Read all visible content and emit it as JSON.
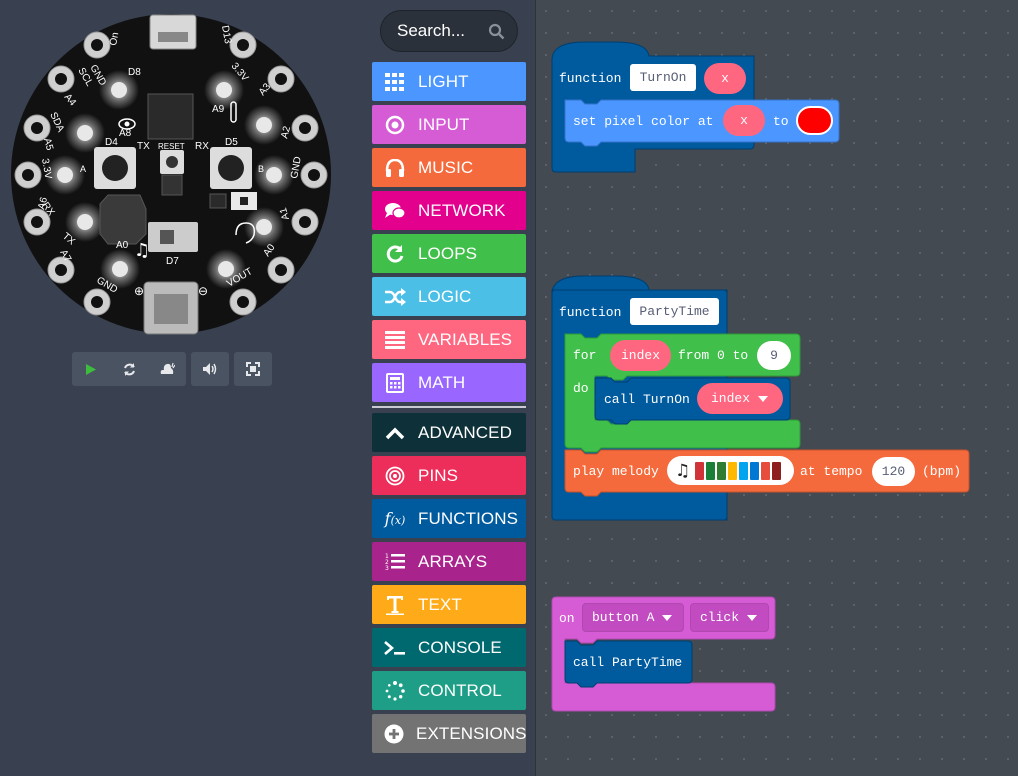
{
  "simulator": {
    "board_labels": {
      "on": "On",
      "d13": "D13",
      "gnd": "GND",
      "three_v": "3.3V",
      "d8": "D8",
      "scl": "SCL",
      "a4": "A4",
      "a3": "A3",
      "a9": "A9",
      "a8": "A8",
      "sda": "SDA",
      "a5": "A5",
      "a2": "A2",
      "d4": "D4",
      "d5": "D5",
      "tx": "TX",
      "rx": "RX",
      "reset": "RESET",
      "a6": "A6",
      "a1": "A1",
      "a0": "A0",
      "a7": "A7",
      "d7": "D7",
      "vout": "VOUT",
      "btn_a": "A",
      "btn_b": "B",
      "plus": "⊕",
      "minus": "⊖"
    },
    "controls": {
      "play": "play-icon",
      "restart": "restart-icon",
      "slowmo": "snail-icon",
      "mute": "speaker-icon",
      "fullscreen": "fullscreen-icon"
    }
  },
  "toolbox": {
    "search": {
      "placeholder": "Search..."
    },
    "categories": [
      {
        "label": "LIGHT",
        "color": "#4c97ff",
        "icon": "grid-icon"
      },
      {
        "label": "INPUT",
        "color": "#d65cd6",
        "icon": "target-icon"
      },
      {
        "label": "MUSIC",
        "color": "#f46a3c",
        "icon": "headphones-icon"
      },
      {
        "label": "NETWORK",
        "color": "#e3008c",
        "icon": "chat-icon"
      },
      {
        "label": "LOOPS",
        "color": "#40bf4a",
        "icon": "refresh-icon"
      },
      {
        "label": "LOGIC",
        "color": "#4cbfe6",
        "icon": "shuffle-icon"
      },
      {
        "label": "VARIABLES",
        "color": "#ff6680",
        "icon": "list-icon"
      },
      {
        "label": "MATH",
        "color": "#9966ff",
        "icon": "calculator-icon"
      },
      {
        "label": "ADVANCED",
        "color": "#0e3139",
        "icon": "chevron-up-icon"
      },
      {
        "label": "PINS",
        "color": "#ee2e5a",
        "icon": "bullseye-icon"
      },
      {
        "label": "FUNCTIONS",
        "color": "#005a9e",
        "icon": "function-icon"
      },
      {
        "label": "ARRAYS",
        "color": "#a8238b",
        "icon": "ordered-list-icon"
      },
      {
        "label": "TEXT",
        "color": "#ffab19",
        "icon": "text-icon"
      },
      {
        "label": "CONSOLE",
        "color": "#006970",
        "icon": "terminal-icon"
      },
      {
        "label": "CONTROL",
        "color": "#1e9e86",
        "icon": "spinner-icon"
      },
      {
        "label": "EXTENSIONS",
        "color": "#737373",
        "icon": "plus-circle-icon"
      }
    ]
  },
  "workspace": {
    "turnon": {
      "keyword": "function",
      "name": "TurnOn",
      "param": "x",
      "stmt": "set pixel color at",
      "arg": "x",
      "to": "to",
      "color": "#ff0000"
    },
    "partytime": {
      "keyword": "function",
      "name": "PartyTime",
      "for": "for",
      "var": "index",
      "from": "from 0 to",
      "end": "9",
      "do": "do",
      "call": "call TurnOn",
      "call_arg": "index",
      "play": "play melody",
      "at_tempo": "at tempo",
      "tempo": "120",
      "bpm": "(bpm)",
      "melody_colors": [
        "#d13438",
        "#1a7f37",
        "#2e7d32",
        "#ffb900",
        "#00a4ef",
        "#0078d4",
        "#e74c3c",
        "#8e1d1d"
      ]
    },
    "onbutton": {
      "on": "on",
      "button": "button A",
      "event": "click",
      "call": "call PartyTime"
    }
  }
}
